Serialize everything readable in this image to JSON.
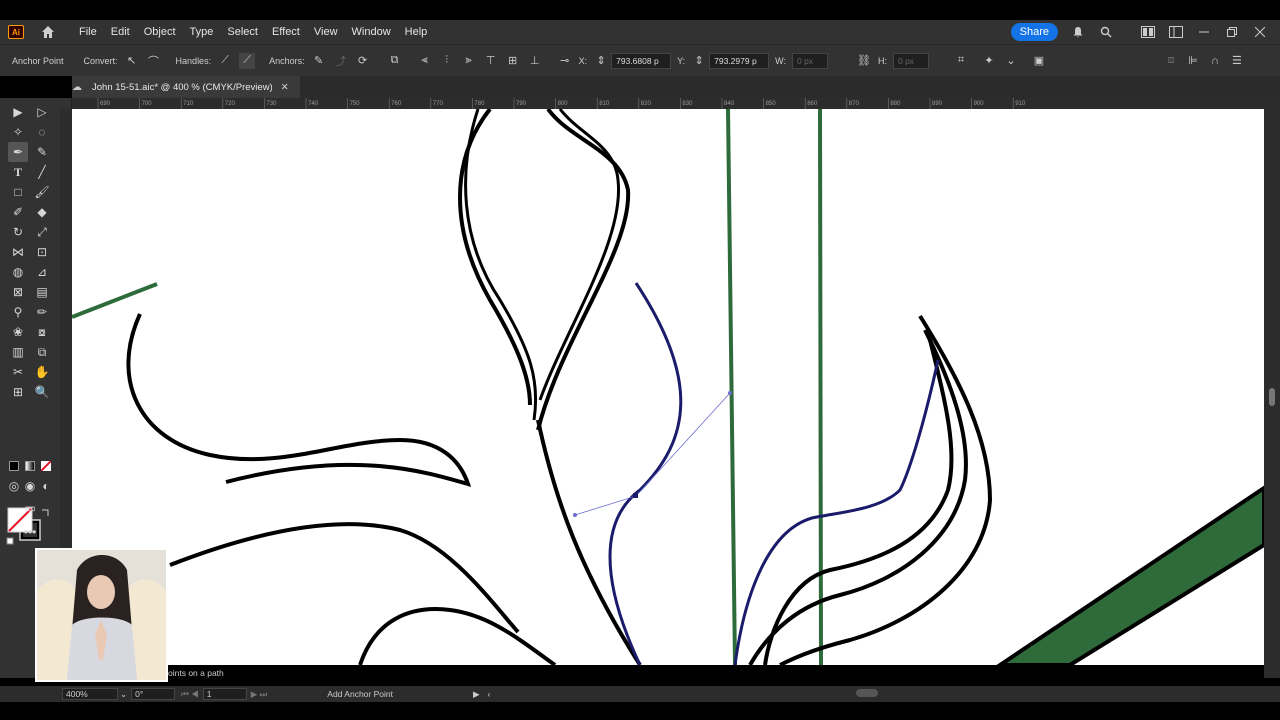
{
  "app": {
    "logo_text": "Ai",
    "menu": [
      "File",
      "Edit",
      "Object",
      "Type",
      "Select",
      "Effect",
      "View",
      "Window",
      "Help"
    ],
    "share_label": "Share"
  },
  "control_bar": {
    "tool_name": "Anchor Point",
    "convert_label": "Convert:",
    "handles_label": "Handles:",
    "anchors_label": "Anchors:",
    "x_label": "X:",
    "x_value": "793.6808 p",
    "y_label": "Y:",
    "y_value": "793.2979 p",
    "w_label": "W:",
    "w_value": "0 px",
    "h_label": "H:",
    "h_value": "0 px"
  },
  "document_tab": {
    "title": "John 15-51.aic* @ 400 % (CMYK/Preview)",
    "close_glyph": "✕"
  },
  "ruler": {
    "ticks": [
      "690",
      "700",
      "710",
      "720",
      "730",
      "740",
      "750",
      "760",
      "770",
      "780",
      "790",
      "800",
      "810",
      "820",
      "830",
      "840",
      "850",
      "860",
      "870",
      "880",
      "890",
      "900",
      "910"
    ]
  },
  "status": {
    "hint": "oints on a path",
    "zoom": "400%",
    "rotation": "0°",
    "artboard": "1",
    "current_tool": "Add Anchor Point"
  },
  "colors": {
    "green_stroke": "#2e6b3a",
    "green_fill": "#2f6b3a",
    "path_selected": "#1b1b6b",
    "accent_blue": "#1473e6"
  }
}
